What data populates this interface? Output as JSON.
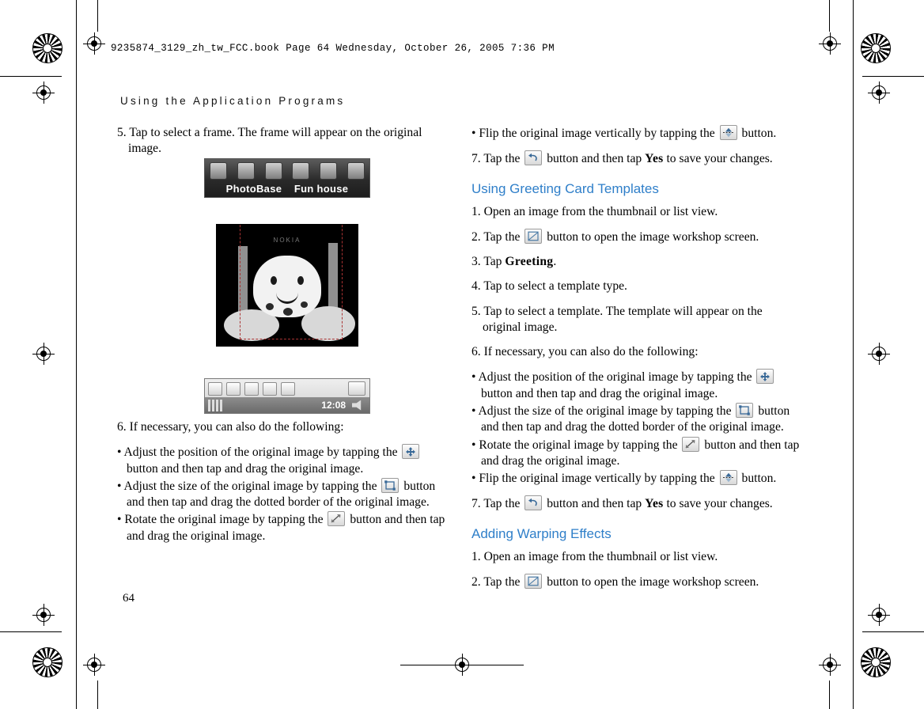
{
  "header": {
    "book_line": "9235874_3129_zh_tw_FCC.book   Page 64  Wednesday, October 26, 2005   7:36 PM",
    "running_head": "Using the Application Programs"
  },
  "page_number": "64",
  "left_column": {
    "step5": {
      "num": "5.",
      "text": "Tap to select a frame. The frame will appear on the original image."
    },
    "step6": {
      "num": "6.",
      "text": "If necessary, you can also do the following:"
    },
    "bullets": [
      {
        "pre": "• Adjust the position of the original image by tapping the",
        "icon": "move-icon",
        "post": "button and then tap and drag the original image."
      },
      {
        "pre": "• Adjust the size of the original image by tapping the",
        "icon": "resize-icon",
        "post": "button and then tap and drag the dotted border of the original image."
      },
      {
        "pre": "• Rotate the original image by tapping the",
        "icon": "rotate-icon",
        "post": "button and then tap and drag the original image."
      }
    ]
  },
  "right_column": {
    "flip_bullet": {
      "pre": "• Flip the original image vertically by tapping the",
      "icon": "flip-icon",
      "post": "button."
    },
    "step7": {
      "num": "7.",
      "pre": "Tap the",
      "icon": "back-icon",
      "mid": "button and then tap",
      "bold": "Yes",
      "post": "to save your changes."
    },
    "sections": [
      {
        "title": "Using Greeting Card Templates",
        "steps": [
          {
            "num": "1.",
            "text": "Open an image from the thumbnail or list view."
          },
          {
            "num": "2.",
            "pre": "Tap the",
            "icon": "workshop-icon",
            "post": "button to open the image workshop screen."
          },
          {
            "num": "3.",
            "pre": "Tap",
            "bold": "Greeting",
            "post": "."
          },
          {
            "num": "4.",
            "text": "Tap to select a template type."
          },
          {
            "num": "5.",
            "text": "Tap to select a template. The template will appear on the original image."
          },
          {
            "num": "6.",
            "text": "If necessary, you can also do the following:"
          }
        ],
        "bullets": [
          {
            "pre": "• Adjust the position of the original image by tapping the",
            "icon": "move-icon",
            "post": "button and then tap and drag the original image."
          },
          {
            "pre": "• Adjust the size of the original image by tapping the",
            "icon": "resize-icon",
            "post": "button and then tap and drag the dotted border of the original image."
          },
          {
            "pre": "• Rotate the original image by tapping the",
            "icon": "rotate-icon",
            "post": "button and then tap and drag the original image."
          },
          {
            "pre": "• Flip the original image vertically by tapping the",
            "icon": "flip-icon",
            "post": "button."
          }
        ],
        "final_step": {
          "num": "7.",
          "pre": "Tap the",
          "icon": "back-icon",
          "mid": "button and then tap",
          "bold": "Yes",
          "post": "to save your changes."
        }
      },
      {
        "title": "Adding Warping Effects",
        "steps": [
          {
            "num": "1.",
            "text": "Open an image from the thumbnail or list view."
          },
          {
            "num": "2.",
            "pre": "Tap the",
            "icon": "workshop-icon",
            "post": "button to open the image workshop screen."
          }
        ]
      }
    ]
  },
  "figures": {
    "toolbar": {
      "labels": [
        "PhotoBase",
        "Fun house"
      ],
      "icon_names": [
        "photo-icon",
        "frame-icon",
        "landscape-icon",
        "crop-icon",
        "brush-icon",
        "rotate-icon"
      ]
    },
    "photo": {
      "watermark": "NOKIA",
      "alt": "Ghost character photo with dashed selection frame"
    },
    "statusbar": {
      "time": "12:08",
      "icon_names": [
        "mail-icon",
        "move-icon",
        "resize-icon",
        "rotate-icon",
        "flip-icon",
        "back-icon"
      ]
    }
  },
  "colors": {
    "section_heading": "#2f7fc9",
    "dashed_frame": "#aa3333",
    "page_background": "#ffffff"
  }
}
